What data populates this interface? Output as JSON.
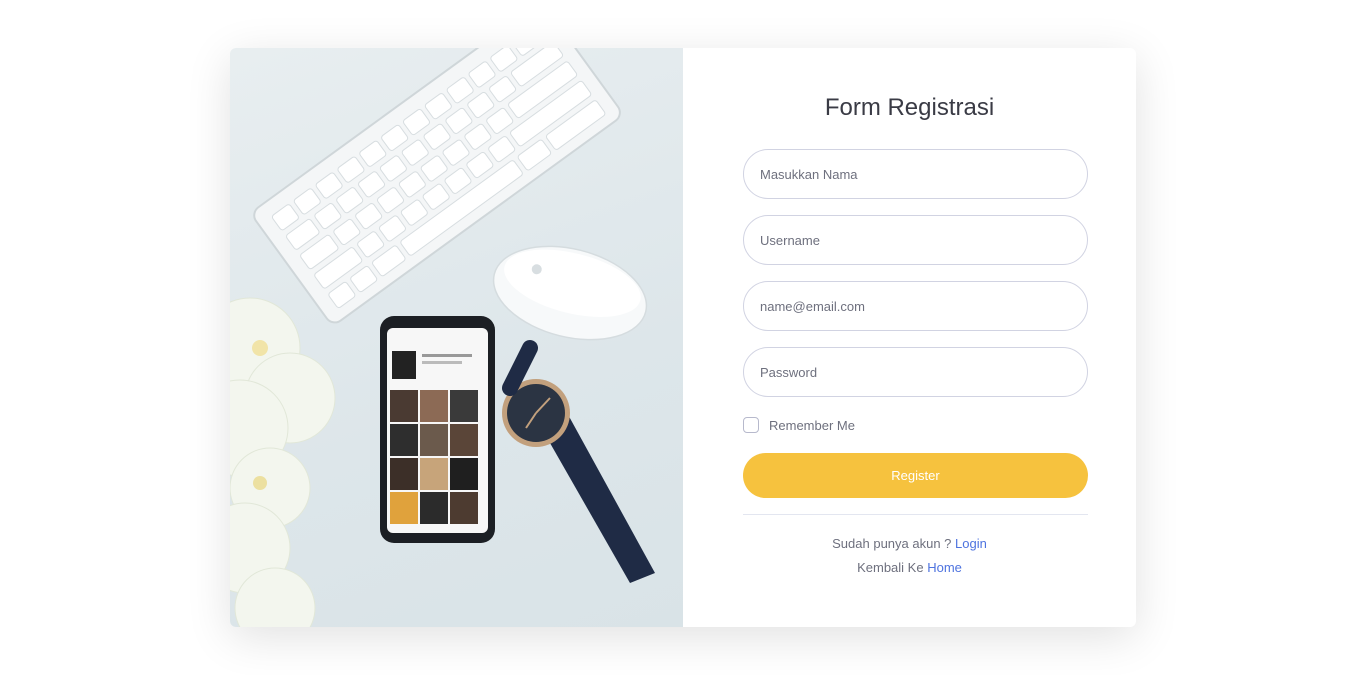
{
  "form": {
    "title": "Form Registrasi",
    "name_placeholder": "Masukkan Nama",
    "username_placeholder": "Username",
    "email_placeholder": "name@email.com",
    "password_placeholder": "Password",
    "remember_label": "Remember Me",
    "register_label": "Register"
  },
  "footer": {
    "account_text": "Sudah punya akun ?",
    "login_link": "Login",
    "back_text": "Kembali Ke",
    "home_link": "Home"
  },
  "colors": {
    "accent": "#f6c23e",
    "link": "#4e73df",
    "text": "#6e707e",
    "title": "#3a3b45"
  },
  "icons": {
    "photo": "desk-photo-keyboard-mouse-phone-watch"
  }
}
